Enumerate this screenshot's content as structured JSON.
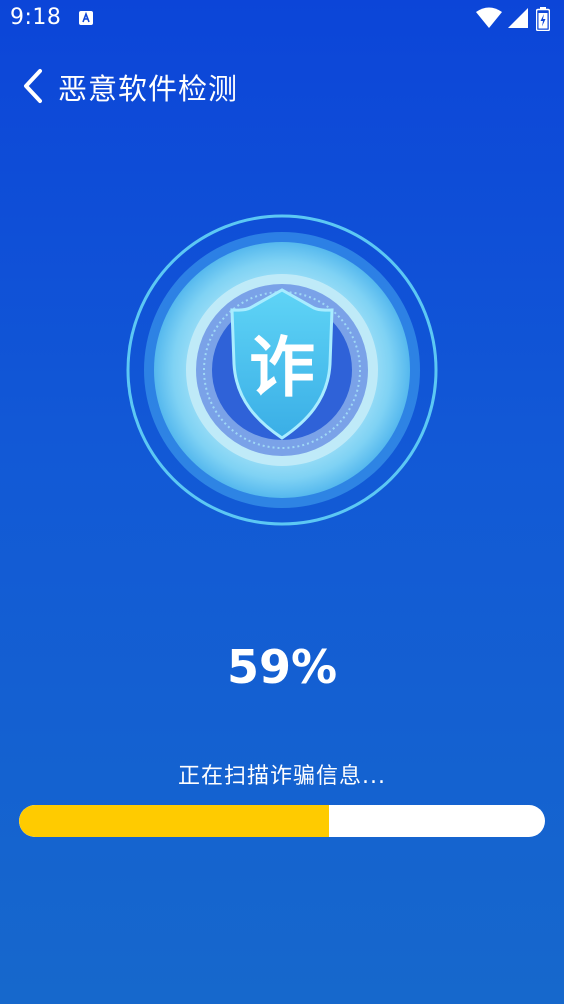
{
  "status_bar": {
    "time": "9:18",
    "icons": [
      "notification-a-icon",
      "wifi-icon",
      "signal-icon",
      "battery-icon"
    ]
  },
  "header": {
    "back_icon": "chevron-left-icon",
    "title": "恶意软件检测"
  },
  "scan": {
    "shield_char": "诈",
    "percent_text": "59%",
    "progress": 0.59,
    "status_text": "正在扫描诈骗信息..."
  },
  "colors": {
    "background_top": "#0c45d8",
    "background_bottom": "#1668cc",
    "progress_fill": "#ffcb00",
    "progress_track": "#ffffff",
    "shield": "#4cc8f0"
  }
}
